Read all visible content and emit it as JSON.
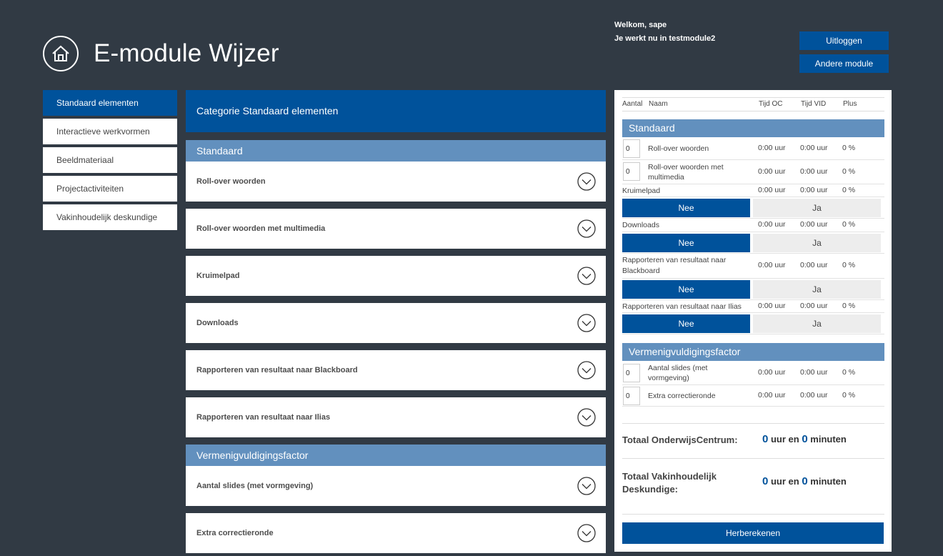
{
  "header": {
    "title": "E-module Wijzer",
    "welcome": "Welkom, sape",
    "module_info": "Je werkt nu in testmodule2",
    "logout_label": "Uitloggen",
    "other_module_label": "Andere module"
  },
  "sidebar": {
    "items": [
      {
        "label": "Standaard elementen"
      },
      {
        "label": "Interactieve werkvormen"
      },
      {
        "label": "Beeldmateriaal"
      },
      {
        "label": "Projectactiviteiten"
      },
      {
        "label": "Vakinhoudelijk deskundige"
      }
    ]
  },
  "main": {
    "category_title": "Categorie Standaard elementen",
    "sections": [
      {
        "title": "Standaard",
        "items": [
          "Roll-over woorden",
          "Roll-over woorden met multimedia",
          "Kruimelpad",
          "Downloads",
          "Rapporteren van resultaat naar Blackboard",
          "Rapporteren van resultaat naar Ilias"
        ]
      },
      {
        "title": "Vermenigvuldigingsfactor",
        "items": [
          "Aantal slides (met vormgeving)",
          "Extra correctieronde"
        ]
      }
    ]
  },
  "panel": {
    "columns": {
      "aantal": "Aantal",
      "naam": "Naam",
      "tijd_oc": "Tijd OC",
      "tijd_vid": "Tijd VID",
      "plus": "Plus"
    },
    "sections": [
      {
        "title": "Standaard",
        "rows": [
          {
            "qty": "0",
            "name": "Roll-over woorden",
            "oc": "0:00 uur",
            "vid": "0:00 uur",
            "plus": "0 %"
          },
          {
            "qty": "0",
            "name": "Roll-over woorden met multimedia",
            "oc": "0:00 uur",
            "vid": "0:00 uur",
            "plus": "0 %"
          },
          {
            "name": "Kruimelpad",
            "oc": "0:00 uur",
            "vid": "0:00 uur",
            "plus": "0 %",
            "no": "Nee",
            "yes": "Ja"
          },
          {
            "name": "Downloads",
            "oc": "0:00 uur",
            "vid": "0:00 uur",
            "plus": "0 %",
            "no": "Nee",
            "yes": "Ja"
          },
          {
            "name": "Rapporteren van resultaat naar Blackboard",
            "oc": "0:00 uur",
            "vid": "0:00 uur",
            "plus": "0 %",
            "no": "Nee",
            "yes": "Ja"
          },
          {
            "name": "Rapporteren van resultaat naar Ilias",
            "oc": "0:00 uur",
            "vid": "0:00 uur",
            "plus": "0 %",
            "no": "Nee",
            "yes": "Ja"
          }
        ]
      },
      {
        "title": "Vermenigvuldigingsfactor",
        "rows": [
          {
            "qty": "0",
            "name": "Aantal slides (met vormgeving)",
            "oc": "0:00 uur",
            "vid": "0:00 uur",
            "plus": "0 %"
          },
          {
            "qty": "0",
            "name": "Extra correctieronde",
            "oc": "0:00 uur",
            "vid": "0:00 uur",
            "plus": "0 %"
          }
        ]
      }
    ],
    "totals": [
      {
        "label": "Totaal OnderwijsCentrum:",
        "hours": "0",
        "minutes": "0"
      },
      {
        "label": "Totaal Vakinhoudelijk Deskundige:",
        "hours": "0",
        "minutes": "0"
      }
    ],
    "unit_hours": "uur en",
    "unit_minutes": "minuten",
    "recalc_label": "Herberekenen"
  },
  "colors": {
    "background": "#313a44",
    "primary": "#00529b",
    "section": "#6290be",
    "toggle_off": "#ededed"
  }
}
